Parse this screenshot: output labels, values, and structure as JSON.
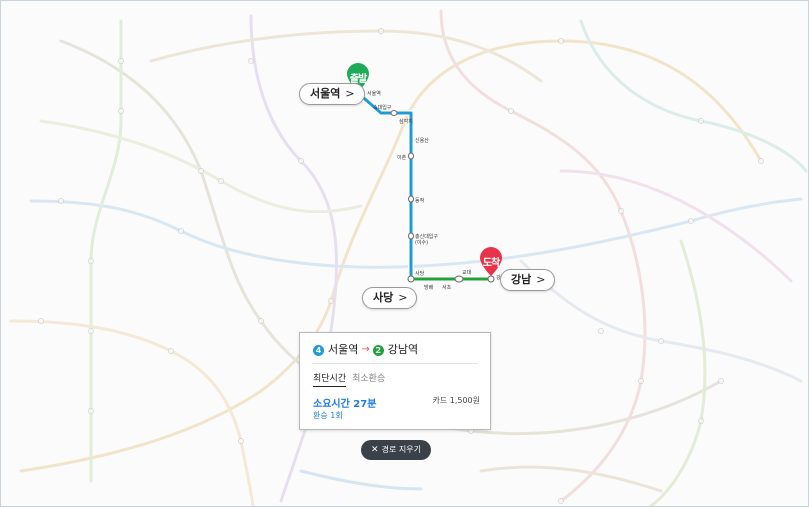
{
  "map": {
    "departure_chip": "서울역",
    "arrival_chip": "강남",
    "transfer_chip": "사당",
    "departure_pin": "출발",
    "arrival_pin": "도착",
    "chip_arrow": ">",
    "route_stations": [
      "서울역",
      "숙대입구",
      "삼각지",
      "신용산",
      "이촌",
      "동작",
      "총신대입구 (이수)",
      "사당",
      "방배",
      "서초",
      "교대",
      "강남"
    ],
    "colors": {
      "line4": "#1e9bd7",
      "line2": "#21a33a",
      "departure_pin": "#1faa57",
      "arrival_pin": "#e8344a"
    }
  },
  "panel": {
    "from_line": "4",
    "from_station": "서울역",
    "to_line": "2",
    "to_station": "강남역",
    "tabs": [
      "최단시간",
      "최소환승"
    ],
    "active_tab": "최단시간",
    "duration": "소요시간 27분",
    "fare": "카드 1,500원",
    "transfers": "환승 1회"
  },
  "clear_button": {
    "label": "경로 지우기",
    "icon": "close-icon"
  }
}
